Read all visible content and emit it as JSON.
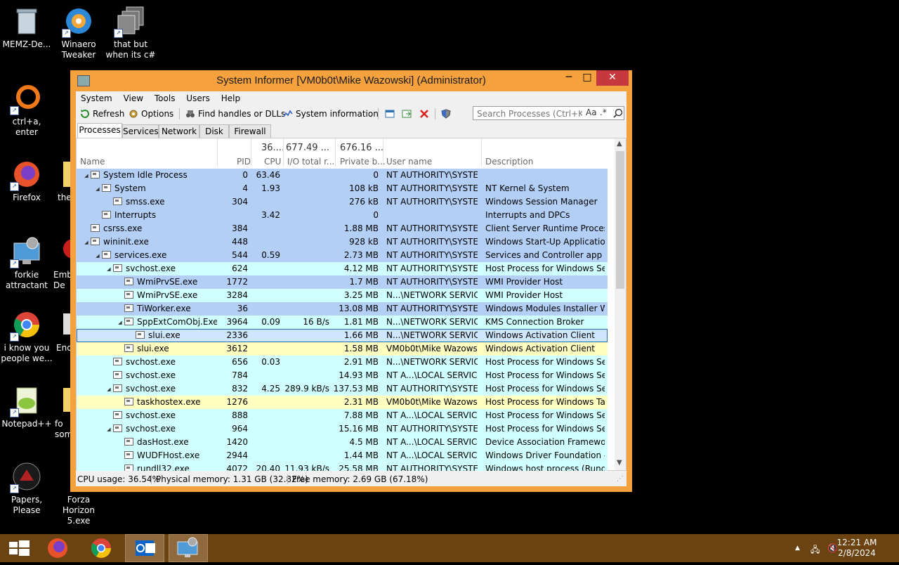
{
  "desktop": {
    "icons": [
      {
        "label": "MEMZ-De...",
        "icon": "recycle-bin-icon"
      },
      {
        "label": "Winaero Tweaker",
        "icon": "winaero-icon"
      },
      {
        "label": "that but when its c#",
        "icon": "windows-stack-icon"
      },
      {
        "label": "ctrl+a, enter",
        "icon": "ring-icon"
      },
      {
        "label": "Firefox",
        "icon": "firefox-icon"
      },
      {
        "label": "the",
        "icon": "folder-icon"
      },
      {
        "label": "forkie attractant",
        "icon": "system-informer-icon"
      },
      {
        "label": "Emb De",
        "icon": "red-app-icon"
      },
      {
        "label": "i know you people we...",
        "icon": "chrome-icon"
      },
      {
        "label": "End",
        "icon": "app-icon"
      },
      {
        "label": "Notepad++",
        "icon": "notepadpp-icon"
      },
      {
        "label": "fo som",
        "icon": "folder-icon"
      },
      {
        "label": "Papers, Please",
        "icon": "papers-please-icon"
      },
      {
        "label": "Forza Horizon 5.exe",
        "icon": "forza-icon"
      }
    ]
  },
  "window": {
    "title": "System Informer [VM0b0t\\Mike Wazowski] (Administrator)",
    "controls": {
      "minimize": "─",
      "maximize": "□",
      "close": "✕"
    },
    "menu": [
      "System",
      "View",
      "Tools",
      "Users",
      "Help"
    ],
    "toolbar": {
      "refresh": "Refresh",
      "options": "Options",
      "find_handles": "Find handles or DLLs",
      "system_information": "System information"
    },
    "search": {
      "placeholder": "Search Processes (Ctrl+K)",
      "case": "Aa",
      "regex": ".*"
    },
    "tabs": [
      "Processes",
      "Services",
      "Network",
      "Disk",
      "Firewall"
    ],
    "columns": {
      "name": "Name",
      "pid": "PID",
      "cpu": "CPU",
      "io": "I/O total r...",
      "private": "Private b...",
      "user": "User name",
      "desc": "Description"
    },
    "summary": {
      "cpu": "36....",
      "io": "677.49 ...",
      "private": "676.16 ..."
    },
    "colors": {
      "system": "#b3cff5",
      "service": "#d0ffff",
      "own": "#fefec0",
      "selected": "#cfe6ff",
      "window_frame": "#f5a13d",
      "taskbar": "#6b4312"
    },
    "rows": [
      {
        "depth": 0,
        "twisty": "◢",
        "name": "System Idle Process",
        "pid": "0",
        "cpu": "63.46",
        "io": "",
        "priv": "0",
        "user": "NT AUTHORITY\\SYSTEM",
        "desc": "",
        "kind": "system",
        "icon": "process-icon"
      },
      {
        "depth": 1,
        "twisty": "◢",
        "name": "System",
        "pid": "4",
        "cpu": "1.93",
        "io": "",
        "priv": "108 kB",
        "user": "NT AUTHORITY\\SYSTEM",
        "desc": "NT Kernel & System",
        "kind": "system",
        "icon": "process-icon"
      },
      {
        "depth": 2,
        "twisty": "",
        "name": "smss.exe",
        "pid": "304",
        "cpu": "",
        "io": "",
        "priv": "276 kB",
        "user": "NT AUTHORITY\\SYSTEM",
        "desc": "Windows Session Manager",
        "kind": "system",
        "icon": "process-icon"
      },
      {
        "depth": 1,
        "twisty": "",
        "name": "Interrupts",
        "pid": "",
        "cpu": "3.42",
        "io": "",
        "priv": "0",
        "user": "",
        "desc": "Interrupts and DPCs",
        "kind": "system",
        "icon": "process-icon"
      },
      {
        "depth": 0,
        "twisty": "",
        "name": "csrss.exe",
        "pid": "384",
        "cpu": "",
        "io": "",
        "priv": "1.88 MB",
        "user": "NT AUTHORITY\\SYSTEM",
        "desc": "Client Server Runtime Process",
        "kind": "system",
        "icon": "process-icon"
      },
      {
        "depth": 0,
        "twisty": "◢",
        "name": "wininit.exe",
        "pid": "448",
        "cpu": "",
        "io": "",
        "priv": "928 kB",
        "user": "NT AUTHORITY\\SYSTEM",
        "desc": "Windows Start-Up Application",
        "kind": "system",
        "icon": "process-icon"
      },
      {
        "depth": 1,
        "twisty": "◢",
        "name": "services.exe",
        "pid": "544",
        "cpu": "0.59",
        "io": "",
        "priv": "2.73 MB",
        "user": "NT AUTHORITY\\SYSTEM",
        "desc": "Services and Controller app",
        "kind": "system",
        "icon": "process-icon"
      },
      {
        "depth": 2,
        "twisty": "◢",
        "name": "svchost.exe",
        "pid": "624",
        "cpu": "",
        "io": "",
        "priv": "4.12 MB",
        "user": "NT AUTHORITY\\SYSTEM",
        "desc": "Host Process for Windows Ser...",
        "kind": "service",
        "icon": "process-icon"
      },
      {
        "depth": 3,
        "twisty": "",
        "name": "WmiPrvSE.exe",
        "pid": "1772",
        "cpu": "",
        "io": "",
        "priv": "1.7 MB",
        "user": "NT AUTHORITY\\SYSTEM",
        "desc": "WMI Provider Host",
        "kind": "system",
        "icon": "wmi-icon"
      },
      {
        "depth": 3,
        "twisty": "",
        "name": "WmiPrvSE.exe",
        "pid": "3284",
        "cpu": "",
        "io": "",
        "priv": "3.25 MB",
        "user": "N...\\NETWORK SERVICE",
        "desc": "WMI Provider Host",
        "kind": "service",
        "icon": "wmi-icon"
      },
      {
        "depth": 3,
        "twisty": "",
        "name": "TiWorker.exe",
        "pid": "36",
        "cpu": "",
        "io": "",
        "priv": "13.08 MB",
        "user": "NT AUTHORITY\\SYSTEM",
        "desc": "Windows Modules Installer W...",
        "kind": "system",
        "icon": "process-icon"
      },
      {
        "depth": 3,
        "twisty": "◢",
        "name": "SppExtComObj.Exe",
        "pid": "3964",
        "cpu": "0.09",
        "io": "16 B/s",
        "priv": "1.81 MB",
        "user": "N...\\NETWORK SERVICE",
        "desc": "KMS Connection Broker",
        "kind": "service",
        "icon": "process-icon"
      },
      {
        "depth": 4,
        "twisty": "",
        "name": "slui.exe",
        "pid": "2336",
        "cpu": "",
        "io": "",
        "priv": "1.66 MB",
        "user": "N...\\NETWORK SERVICE",
        "desc": "Windows Activation Client",
        "kind": "selected",
        "icon": "key-icon"
      },
      {
        "depth": 3,
        "twisty": "",
        "name": "slui.exe",
        "pid": "3612",
        "cpu": "",
        "io": "",
        "priv": "1.58 MB",
        "user": "VM0b0t\\Mike Wazowski",
        "desc": "Windows Activation Client",
        "kind": "own",
        "icon": "key-icon"
      },
      {
        "depth": 2,
        "twisty": "",
        "name": "svchost.exe",
        "pid": "656",
        "cpu": "0.03",
        "io": "",
        "priv": "2.91 MB",
        "user": "N...\\NETWORK SERVICE",
        "desc": "Host Process for Windows Ser...",
        "kind": "service",
        "icon": "process-icon"
      },
      {
        "depth": 2,
        "twisty": "",
        "name": "svchost.exe",
        "pid": "784",
        "cpu": "",
        "io": "",
        "priv": "14.93 MB",
        "user": "NT A...\\LOCAL SERVICE",
        "desc": "Host Process for Windows Ser...",
        "kind": "service",
        "icon": "process-icon"
      },
      {
        "depth": 2,
        "twisty": "◢",
        "name": "svchost.exe",
        "pid": "832",
        "cpu": "4.25",
        "io": "289.9 kB/s",
        "priv": "137.53 MB",
        "user": "NT AUTHORITY\\SYSTEM",
        "desc": "Host Process for Windows Ser...",
        "kind": "service",
        "icon": "process-icon"
      },
      {
        "depth": 3,
        "twisty": "",
        "name": "taskhostex.exe",
        "pid": "1276",
        "cpu": "",
        "io": "",
        "priv": "2.31 MB",
        "user": "VM0b0t\\Mike Wazowski",
        "desc": "Host Process for Windows Tas...",
        "kind": "own",
        "icon": "process-icon"
      },
      {
        "depth": 2,
        "twisty": "",
        "name": "svchost.exe",
        "pid": "888",
        "cpu": "",
        "io": "",
        "priv": "7.88 MB",
        "user": "NT A...\\LOCAL SERVICE",
        "desc": "Host Process for Windows Ser...",
        "kind": "service",
        "icon": "process-icon"
      },
      {
        "depth": 2,
        "twisty": "◢",
        "name": "svchost.exe",
        "pid": "964",
        "cpu": "",
        "io": "",
        "priv": "15.16 MB",
        "user": "NT AUTHORITY\\SYSTEM",
        "desc": "Host Process for Windows Ser...",
        "kind": "service",
        "icon": "process-icon"
      },
      {
        "depth": 3,
        "twisty": "",
        "name": "dasHost.exe",
        "pid": "1420",
        "cpu": "",
        "io": "",
        "priv": "4.5 MB",
        "user": "NT A...\\LOCAL SERVICE",
        "desc": "Device Association Framewor...",
        "kind": "service",
        "icon": "process-icon"
      },
      {
        "depth": 3,
        "twisty": "",
        "name": "WUDFHost.exe",
        "pid": "2944",
        "cpu": "",
        "io": "",
        "priv": "1.44 MB",
        "user": "NT A...\\LOCAL SERVICE",
        "desc": "Windows Driver Foundation - ...",
        "kind": "service",
        "icon": "process-icon"
      },
      {
        "depth": 3,
        "twisty": "",
        "name": "rundll32.exe",
        "pid": "4072",
        "cpu": "20.40",
        "io": "11.93 kB/s",
        "priv": "25.58 MB",
        "user": "NT AUTHORITY\\SYSTEM",
        "desc": "Windows host process (Rundll...",
        "kind": "service",
        "icon": "process-icon"
      }
    ],
    "status": {
      "cpu": "CPU usage: 36.54%",
      "physical": "Physical memory: 1.31 GB (32.82%)",
      "free": "Free memory: 2.69 GB (67.18%)"
    }
  },
  "taskbar": {
    "apps": [
      "windows-start-icon",
      "firefox-icon",
      "chrome-icon",
      "outlook-icon",
      "system-informer-icon"
    ],
    "time": "12:21 AM",
    "date": "2/8/2024"
  }
}
